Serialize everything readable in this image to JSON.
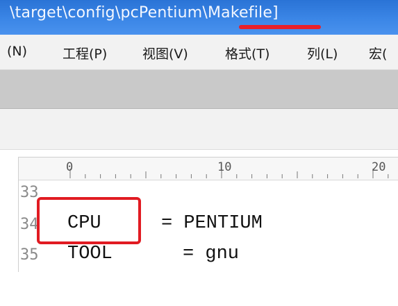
{
  "window": {
    "title": "\\target\\config\\pcPentium\\Makefile]"
  },
  "menu": {
    "items": [
      {
        "label": "(N)"
      },
      {
        "label": "工程(P)"
      },
      {
        "label": "视图(V)"
      },
      {
        "label": "格式(T)"
      },
      {
        "label": "列(L)"
      },
      {
        "label": "宏("
      }
    ]
  },
  "ruler": {
    "marks": [
      "0",
      "10",
      "20"
    ]
  },
  "editor": {
    "lines": [
      {
        "number": "33",
        "name": "",
        "value": ""
      },
      {
        "number": "34",
        "name": "CPU",
        "value": "= PENTIUM"
      },
      {
        "number": "35",
        "name": "TOOL",
        "value": "= gnu"
      }
    ]
  },
  "colors": {
    "titlebar": "#3b86e6",
    "highlight": "#e11b22"
  }
}
